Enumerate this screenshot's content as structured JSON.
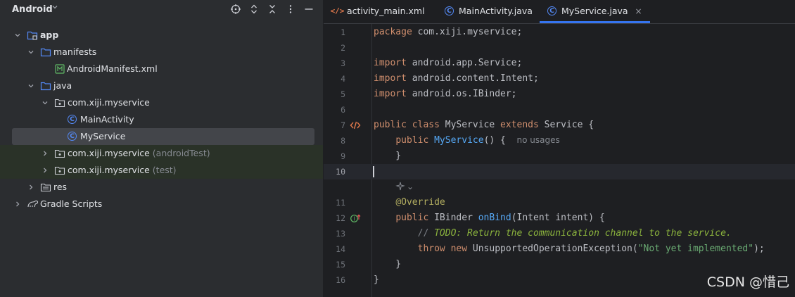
{
  "panel": {
    "title": "Android",
    "header_icons": [
      "crosshair-icon",
      "expand-icon",
      "collapse-icon",
      "more-icon",
      "minimize-icon"
    ]
  },
  "tree": [
    {
      "label": "app",
      "suffix": "",
      "icon": "module-icon",
      "expanded": true
    },
    {
      "label": "manifests",
      "suffix": "",
      "icon": "folder-icon",
      "expanded": true
    },
    {
      "label": "AndroidManifest.xml",
      "suffix": "",
      "icon": "manifest-icon"
    },
    {
      "label": "java",
      "suffix": "",
      "icon": "folder-icon",
      "expanded": true
    },
    {
      "label": "com.xiji.myservice",
      "suffix": "",
      "icon": "package-icon",
      "expanded": true
    },
    {
      "label": "MainActivity",
      "suffix": "",
      "icon": "class-icon"
    },
    {
      "label": "MyService",
      "suffix": "",
      "icon": "class-icon",
      "selected": true
    },
    {
      "label": "com.xiji.myservice",
      "suffix": "(androidTest)",
      "icon": "package-icon",
      "expanded": false
    },
    {
      "label": "com.xiji.myservice",
      "suffix": "(test)",
      "icon": "package-icon",
      "expanded": false
    },
    {
      "label": "res",
      "suffix": "",
      "icon": "res-folder-icon",
      "expanded": false
    },
    {
      "label": "Gradle Scripts",
      "suffix": "",
      "icon": "gradle-icon",
      "expanded": false
    }
  ],
  "tabs": [
    {
      "label": "activity_main.xml",
      "icon": "xml-icon"
    },
    {
      "label": "MainActivity.java",
      "icon": "class-icon"
    },
    {
      "label": "MyService.java",
      "icon": "class-icon",
      "active": true,
      "close": "×"
    }
  ],
  "editor": {
    "current_line": 10,
    "lines": [
      {
        "n": "1",
        "tokens": [
          [
            "kw",
            "package"
          ],
          [
            "p",
            " com.xiji.myservice;"
          ]
        ]
      },
      {
        "n": "2",
        "tokens": []
      },
      {
        "n": "3",
        "tokens": [
          [
            "kw",
            "import"
          ],
          [
            "p",
            " android.app.Service;"
          ]
        ]
      },
      {
        "n": "4",
        "tokens": [
          [
            "kw",
            "import"
          ],
          [
            "p",
            " android.content.Intent;"
          ]
        ]
      },
      {
        "n": "5",
        "tokens": [
          [
            "kw",
            "import"
          ],
          [
            "p",
            " android.os.IBinder;"
          ]
        ]
      },
      {
        "n": "6",
        "tokens": []
      },
      {
        "n": "7",
        "tokens": [
          [
            "kw",
            "public class"
          ],
          [
            "p",
            " MyService "
          ],
          [
            "kw",
            "extends"
          ],
          [
            "p",
            " Service {"
          ]
        ],
        "gutter": "class-marker-icon"
      },
      {
        "n": "8",
        "tokens": [
          [
            "p",
            "    "
          ],
          [
            "kw",
            "public"
          ],
          [
            "p",
            " "
          ],
          [
            "fn",
            "MyService"
          ],
          [
            "p",
            "() {  "
          ],
          [
            "hint",
            "no usages"
          ]
        ]
      },
      {
        "n": "9",
        "tokens": [
          [
            "p",
            "    }"
          ]
        ]
      },
      {
        "n": "10",
        "tokens": []
      },
      {
        "n": "",
        "tokens": []
      },
      {
        "n": "11",
        "tokens": [
          [
            "p",
            "    "
          ],
          [
            "ann",
            "@Override"
          ]
        ]
      },
      {
        "n": "12",
        "tokens": [
          [
            "p",
            "    "
          ],
          [
            "kw",
            "public"
          ],
          [
            "p",
            " IBinder "
          ],
          [
            "fn",
            "onBind"
          ],
          [
            "p",
            "(Intent intent) {"
          ]
        ],
        "gutter": "implements-icon"
      },
      {
        "n": "13",
        "tokens": [
          [
            "cm",
            "        // "
          ],
          [
            "todo",
            "TODO: Return the communication channel to the service."
          ]
        ]
      },
      {
        "n": "14",
        "tokens": [
          [
            "p",
            "        "
          ],
          [
            "kw",
            "throw new"
          ],
          [
            "p",
            " UnsupportedOperationException("
          ],
          [
            "str",
            "\"Not yet implemented\""
          ],
          [
            "p",
            ");"
          ]
        ]
      },
      {
        "n": "15",
        "tokens": [
          [
            "p",
            "    }"
          ]
        ]
      },
      {
        "n": "16",
        "tokens": [
          [
            "p",
            "}"
          ]
        ]
      }
    ],
    "ai_hint": "⌄"
  },
  "watermark": "CSDN @惜己",
  "colors": {
    "keyword": "#cf8e6d",
    "function": "#56a8f5",
    "annotation": "#b3ae60",
    "string": "#6aab73",
    "todo": "#8bb33d",
    "accent": "#3574f0"
  }
}
